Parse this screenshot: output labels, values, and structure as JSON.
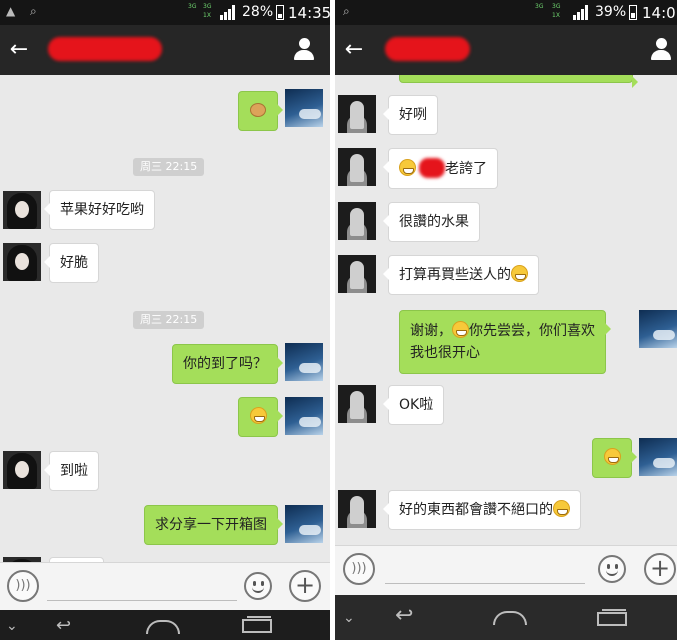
{
  "left": {
    "status": {
      "network_a": "3G",
      "network_b": "3G",
      "network_c": "1X",
      "battery": "28%",
      "time": "14:35"
    },
    "messages": [
      {
        "type": "time",
        "text": "周三 22:15"
      },
      {
        "type": "in",
        "text": "苹果好好吃哟"
      },
      {
        "type": "in",
        "text": "好脆"
      },
      {
        "type": "time",
        "text": "周三 22:15"
      },
      {
        "type": "out",
        "text": "你的到了吗？"
      },
      {
        "type": "in",
        "text": "到啦"
      },
      {
        "type": "out",
        "text": "求分享一下开箱图"
      }
    ]
  },
  "right": {
    "status": {
      "network_a": "3G",
      "network_b": "3G",
      "network_c": "1X",
      "battery": "39%",
      "time": "14:0"
    },
    "messages": [
      {
        "type": "in",
        "text": "好咧"
      },
      {
        "type": "in",
        "text": "老誇了"
      },
      {
        "type": "in",
        "text": "很讚的水果"
      },
      {
        "type": "in",
        "text": "打算再買些送人的"
      },
      {
        "type": "out",
        "line1": "谢谢，",
        "line1_after": "你先尝尝，你们喜欢",
        "line2": "我也很开心"
      },
      {
        "type": "in",
        "text": "OK啦"
      },
      {
        "type": "in",
        "text": "好的東西都會讚不絕口的"
      }
    ]
  },
  "icons": {
    "back": "back-arrow-icon",
    "contact": "person-icon",
    "voice": "voice-icon",
    "emoji": "smile-icon",
    "add": "plus-icon",
    "nav_back": "nav-back-icon",
    "nav_home": "nav-home-icon",
    "nav_recent": "nav-recent-icon"
  },
  "colors": {
    "titlebar": "#262626",
    "chat_bg": "#e9e9e9",
    "outgoing_bubble": "#a4de5a",
    "incoming_bubble": "#ffffff",
    "redaction": "#e5141b"
  }
}
